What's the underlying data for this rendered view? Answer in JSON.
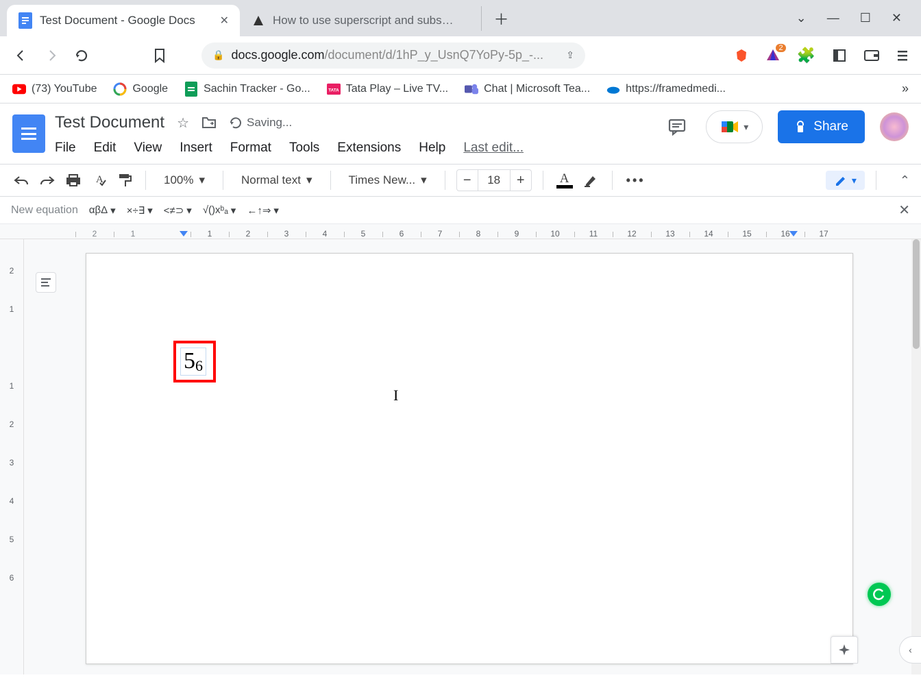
{
  "browser": {
    "tabs": [
      {
        "title": "Test Document - Google Docs",
        "active": true
      },
      {
        "title": "How to use superscript and subscript",
        "active": false
      }
    ],
    "url_host": "docs.google.com",
    "url_path": "/document/d/1hP_y_UsnQ7YoPy-5p_-...",
    "ext_badge": "2"
  },
  "bookmarks": [
    {
      "label": "(73) YouTube",
      "icon": "youtube"
    },
    {
      "label": "Google",
      "icon": "google"
    },
    {
      "label": "Sachin Tracker - Go...",
      "icon": "sheets"
    },
    {
      "label": "Tata Play – Live TV...",
      "icon": "tata"
    },
    {
      "label": "Chat | Microsoft Tea...",
      "icon": "teams"
    },
    {
      "label": "https://framedmedi...",
      "icon": "onedrive"
    }
  ],
  "docs": {
    "title": "Test Document",
    "status": "Saving...",
    "menus": [
      "File",
      "Edit",
      "View",
      "Insert",
      "Format",
      "Tools",
      "Extensions",
      "Help"
    ],
    "last_edit": "Last edit...",
    "share_label": "Share"
  },
  "toolbar": {
    "zoom": "100%",
    "style": "Normal text",
    "font": "Times New...",
    "font_size": "18"
  },
  "equation": {
    "label": "New equation",
    "groups": [
      "αβΔ",
      "×÷∃",
      "<≠⊃",
      "√()xᵇₐ",
      "←↑⇒"
    ]
  },
  "ruler": [
    "2",
    "1",
    "",
    "1",
    "2",
    "3",
    "4",
    "5",
    "6",
    "7",
    "8",
    "9",
    "10",
    "11",
    "12",
    "13",
    "14",
    "15",
    "16",
    "17",
    "1"
  ],
  "ruler_v": [
    "2",
    "1",
    "",
    "1",
    "2",
    "3",
    "4",
    "5",
    "6"
  ],
  "content": {
    "equation_main": "5",
    "equation_sub": "6",
    "cursor_char": "I"
  }
}
